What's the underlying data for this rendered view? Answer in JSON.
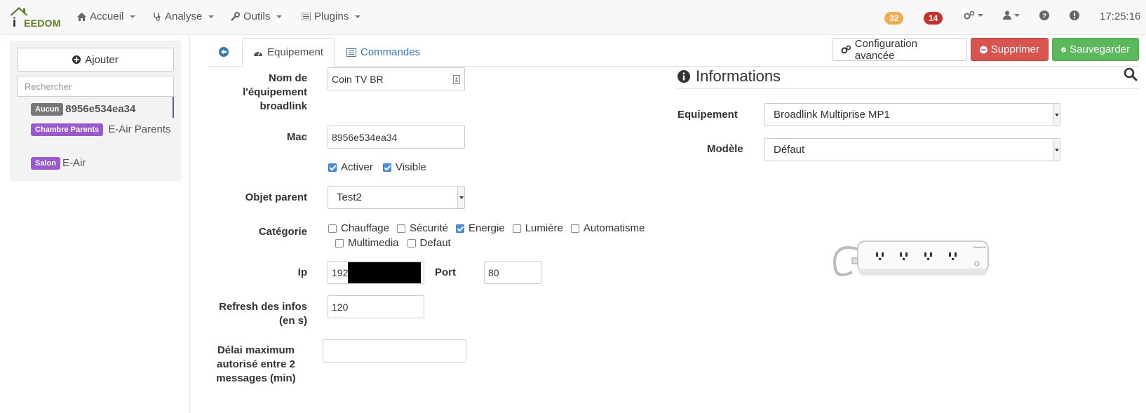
{
  "navbar": {
    "logo_text": "EEDOM",
    "logo_letter": "i",
    "menus": [
      {
        "label": "Accueil",
        "icon": "home-icon"
      },
      {
        "label": "Analyse",
        "icon": "stethoscope-icon"
      },
      {
        "label": "Outils",
        "icon": "wrench-icon"
      },
      {
        "label": "Plugins",
        "icon": "list-icon"
      }
    ],
    "badge_orange": "32",
    "badge_red": "14",
    "time": "17:25:16",
    "colors": {
      "badge_orange": "#f0ad4e",
      "badge_red": "#c9302c"
    }
  },
  "sidebar": {
    "add_label": "Ajouter",
    "search_placeholder": "Rechercher",
    "items": [
      {
        "tag": "Aucun",
        "name": "8956e534ea34",
        "tag_color": "#777777"
      },
      {
        "tag": "Chambre Parents",
        "name": "E-Air Parents",
        "tag_color": "#9b59d0"
      },
      {
        "tag": "Salon",
        "name": "E-Air",
        "tag_color": "#9b59d0"
      }
    ]
  },
  "tabs": {
    "equipment": "Equipement",
    "commands": "Commandes"
  },
  "actions": {
    "advanced": "Configuration avancée",
    "delete": "Supprimer",
    "save": "Sauvegarder"
  },
  "form": {
    "name_label_1": "Nom de",
    "name_label_2": "l'équipement",
    "name_label_3": "broadlink",
    "name_value": "Coin TV BR",
    "mac_label": "Mac",
    "mac_value": "8956e534ea34",
    "activate_label": "Activer",
    "visible_label": "Visible",
    "parent_label": "Objet parent",
    "parent_value": "Test2",
    "category_label": "Catégorie",
    "categories": [
      {
        "label": "Chauffage",
        "checked": false
      },
      {
        "label": "Sécurité",
        "checked": false
      },
      {
        "label": "Energie",
        "checked": true
      },
      {
        "label": "Lumière",
        "checked": false
      },
      {
        "label": "Automatisme",
        "checked": false
      },
      {
        "label": "Multimedia",
        "checked": false
      },
      {
        "label": "Defaut",
        "checked": false
      }
    ],
    "ip_label": "Ip",
    "ip_value": "192.",
    "port_label": "Port",
    "port_value": "80",
    "refresh_label_1": "Refresh des infos",
    "refresh_label_2": "(en s)",
    "refresh_value": "120",
    "delay_label_1": "Délai maximum",
    "delay_label_2": "autorisé entre 2",
    "delay_label_3": "messages (min)",
    "delay_value": ""
  },
  "info": {
    "title": "Informations",
    "equipment_label": "Equipement",
    "equipment_value": "Broadlink Multiprise MP1",
    "model_label": "Modèle",
    "model_value": "Défaut"
  }
}
